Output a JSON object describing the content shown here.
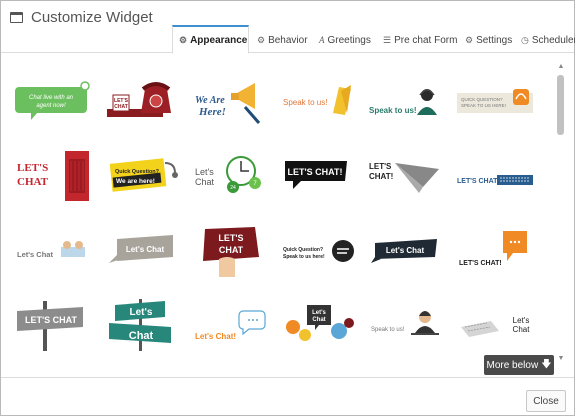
{
  "window": {
    "title": "Customize Widget",
    "icon": "window-icon"
  },
  "tabs": [
    {
      "label": "Appearance",
      "icon": "gear-icon",
      "active": true
    },
    {
      "label": "Behavior",
      "icon": "gears-icon",
      "active": false
    },
    {
      "label": "Greetings",
      "icon": "font-icon",
      "active": false
    },
    {
      "label": "Pre chat Form",
      "icon": "list-icon",
      "active": false
    },
    {
      "label": "Settings",
      "icon": "gear-icon",
      "active": false
    },
    {
      "label": "Scheduler",
      "icon": "clock-icon",
      "active": false
    }
  ],
  "gallery": {
    "widgets": [
      {
        "text": [
          "Chat live with an",
          "agent now!"
        ]
      },
      {
        "text": [
          "LET'S",
          "CHAT"
        ]
      },
      {
        "text": [
          "We Are",
          "Here!"
        ]
      },
      {
        "text": [
          "Speak to us!"
        ]
      },
      {
        "text": [
          "Speak to us!"
        ]
      },
      {
        "text": [
          "QUICK QUESTION?",
          "SPEAK TO US HERE!"
        ]
      },
      {
        "text": [
          "LET'S",
          "CHAT"
        ]
      },
      {
        "text": [
          "Quick Question?",
          "We are here!"
        ]
      },
      {
        "text": [
          "Let's",
          "Chat",
          "24",
          "7"
        ]
      },
      {
        "text": [
          "LET'S CHAT!"
        ]
      },
      {
        "text": [
          "LET'S",
          "CHAT!"
        ]
      },
      {
        "text": [
          "LET'S CHAT"
        ]
      },
      {
        "text": [
          "Let's Chat"
        ]
      },
      {
        "text": [
          "Let's Chat"
        ]
      },
      {
        "text": [
          "LET'S",
          "CHAT"
        ]
      },
      {
        "text": [
          "Quick Question?",
          "Speak to us here!"
        ]
      },
      {
        "text": [
          "Let's Chat"
        ]
      },
      {
        "text": [
          "LET'S CHAT!"
        ]
      },
      {
        "text": [
          "LET'S CHAT"
        ]
      },
      {
        "text": [
          "Let's",
          "Chat"
        ]
      },
      {
        "text": [
          "Let's Chat!"
        ]
      },
      {
        "text": [
          "Let's",
          "Chat"
        ]
      },
      {
        "text": [
          "Speak to us!"
        ]
      },
      {
        "text": [
          "Let's",
          "Chat"
        ]
      }
    ]
  },
  "more_button": {
    "label": "More below",
    "icon": "arrow-down-icon"
  },
  "close_button": {
    "label": "Close"
  },
  "colors": {
    "accent": "#3f8fce",
    "dark_button": "#4a4a4a"
  }
}
